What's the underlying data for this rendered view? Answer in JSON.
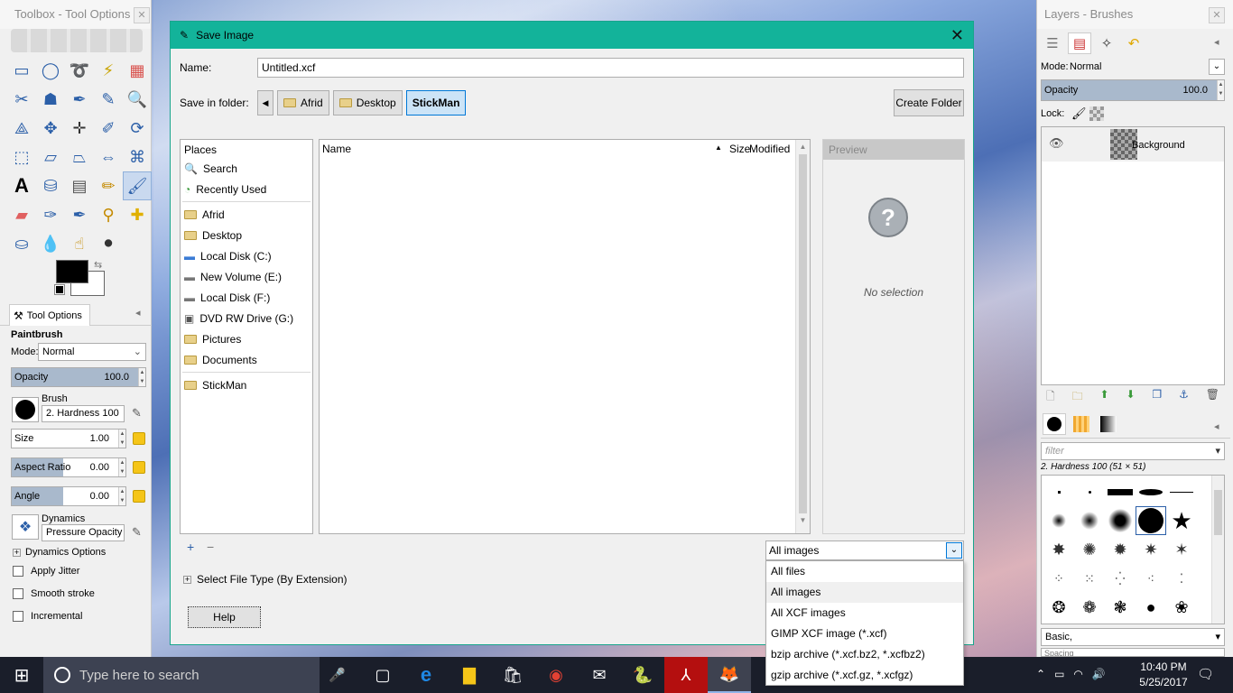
{
  "toolbox": {
    "title": "Toolbox - Tool Options",
    "tool_options_tab": "Tool Options",
    "tool_name": "Paintbrush",
    "mode_label": "Mode:",
    "mode_value": "Normal",
    "opacity_label": "Opacity",
    "opacity_value": "100.0",
    "opacity_fraction": 1.0,
    "brush_label": "Brush",
    "brush_value": "2. Hardness 100",
    "size_label": "Size",
    "size_value": "1.00",
    "aspect_label": "Aspect Ratio",
    "aspect_value": "0.00",
    "angle_label": "Angle",
    "angle_value": "0.00",
    "dynamics_label": "Dynamics",
    "dynamics_value": "Pressure Opacity",
    "dynamics_options": "Dynamics Options",
    "apply_jitter": "Apply Jitter",
    "smooth_stroke": "Smooth stroke",
    "incremental": "Incremental"
  },
  "dialog": {
    "title": "Save Image",
    "name_label": "Name:",
    "name_value": "Untitled.xcf",
    "save_in_label": "Save in folder:",
    "breadcrumbs": [
      "Afrid",
      "Desktop",
      "StickMan"
    ],
    "create_folder": "Create Folder",
    "places_header": "Places",
    "places": [
      "Search",
      "Recently Used",
      "Afrid",
      "Desktop",
      "Local Disk (C:)",
      "New Volume (E:)",
      "Local Disk (F:)",
      "DVD RW Drive (G:)",
      "Pictures",
      "Documents",
      "StickMan"
    ],
    "columns": {
      "name": "Name",
      "size": "Size",
      "modified": "Modified"
    },
    "preview_header": "Preview",
    "no_selection": "No selection",
    "filter_value": "All images",
    "filter_options": [
      "All files",
      "All images",
      "All XCF images",
      "GIMP XCF image (*.xcf)",
      "bzip archive (*.xcf.bz2, *.xcfbz2)",
      "gzip archive (*.xcf.gz, *.xcfgz)"
    ],
    "select_file_type": "Select File Type (By Extension)",
    "help": "Help"
  },
  "layers": {
    "title": "Layers - Brushes",
    "mode_label": "Mode:",
    "mode_value": "Normal",
    "opacity_label": "Opacity",
    "opacity_value": "100.0",
    "lock_label": "Lock:",
    "layer_name": "Background",
    "filter_placeholder": "filter",
    "brush_info": "2. Hardness 100 (51 × 51)",
    "brush_set": "Basic,",
    "spacing_label": "Spacing"
  },
  "taskbar": {
    "search_placeholder": "Type here to search",
    "time": "10:40 PM",
    "date": "5/25/2017"
  },
  "colors": {
    "dialog_title_bar": "#13b39a",
    "accent": "#0078d7",
    "taskbar": "#1a1e2a"
  }
}
